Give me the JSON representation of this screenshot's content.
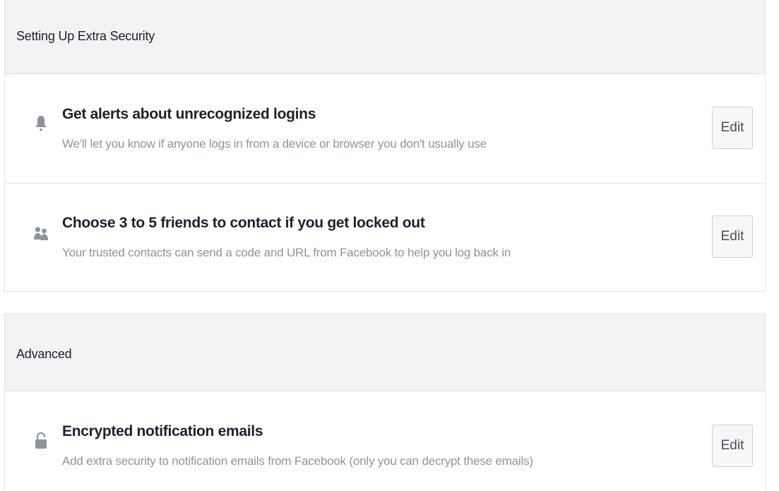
{
  "extra_security": {
    "title": "Setting Up Extra Security",
    "items": [
      {
        "icon": "bell-icon",
        "title": "Get alerts about unrecognized logins",
        "description": "We'll let you know if anyone logs in from a device or browser you don't usually use",
        "edit_label": "Edit"
      },
      {
        "icon": "friends-icon",
        "title": "Choose 3 to 5 friends to contact if you get locked out",
        "description": "Your trusted contacts can send a code and URL from Facebook to help you log back in",
        "edit_label": "Edit"
      }
    ]
  },
  "advanced": {
    "title": "Advanced",
    "items": [
      {
        "icon": "lock-icon",
        "title": "Encrypted notification emails",
        "description": "Add extra security to notification emails from Facebook (only you can decrypt these emails)",
        "edit_label": "Edit"
      }
    ]
  },
  "colors": {
    "header_background": "#f2f3f5",
    "title_text": "#1d2129",
    "description_text": "#90949c",
    "icon": "#8d949e",
    "button_background": "#f6f7f9",
    "button_border": "#ced0d4"
  }
}
